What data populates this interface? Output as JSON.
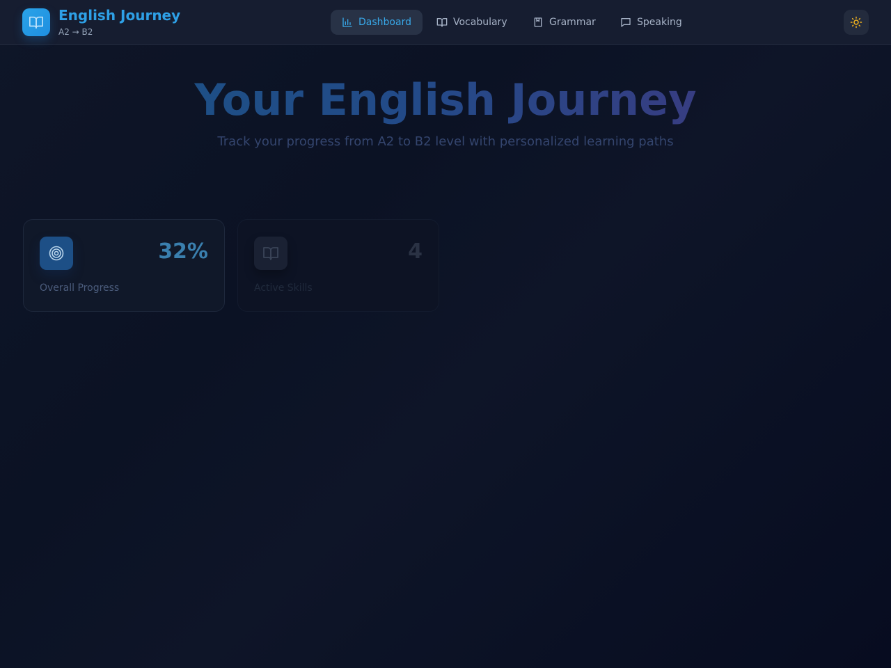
{
  "app": {
    "title": "English Journey",
    "subtitle": "A2 → B2"
  },
  "nav": {
    "items": [
      {
        "label": "Dashboard",
        "icon": "bar-chart-icon",
        "active": true
      },
      {
        "label": "Vocabulary",
        "icon": "open-book-icon",
        "active": false
      },
      {
        "label": "Grammar",
        "icon": "notebook-icon",
        "active": false
      },
      {
        "label": "Speaking",
        "icon": "message-icon",
        "active": false
      }
    ]
  },
  "theme_toggle": {
    "icon": "sun-icon"
  },
  "hero": {
    "title": "Your English Journey",
    "subtitle": "Track your progress from A2 to B2 level with personalized learning paths"
  },
  "stats": [
    {
      "icon": "target-icon",
      "value": "32%",
      "label": "Overall Progress"
    },
    {
      "icon": "open-book-icon",
      "value": "4",
      "label": "Active Skills"
    }
  ],
  "colors": {
    "accent": "#2ea0e6",
    "nav_active_bg": "#283246",
    "background": "#0b1224",
    "sun": "#f5b51e"
  }
}
